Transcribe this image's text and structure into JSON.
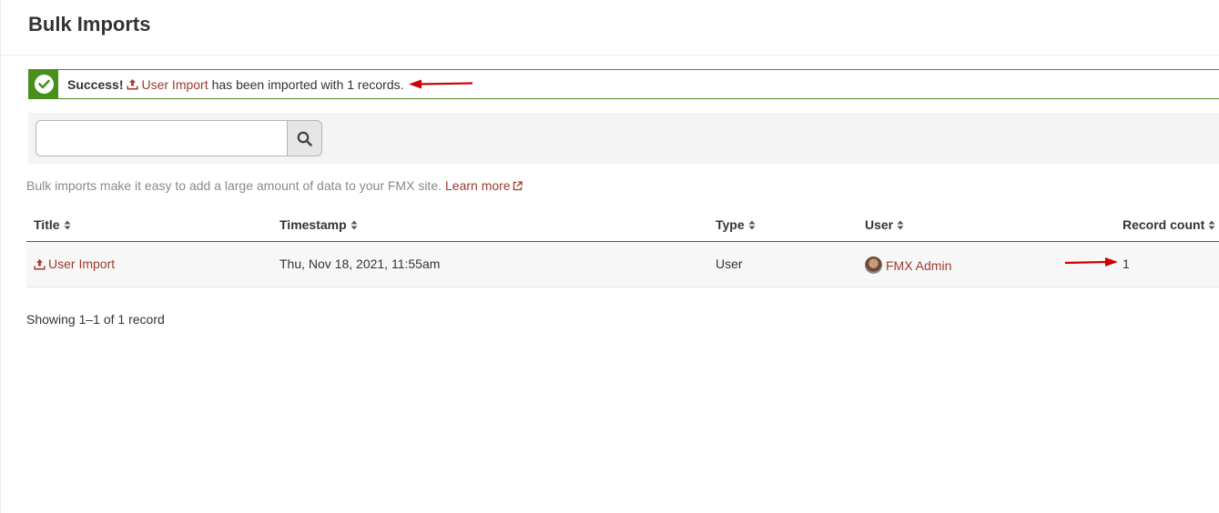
{
  "page": {
    "title": "Bulk Imports"
  },
  "alert": {
    "strong": "Success!",
    "link": "User Import",
    "message": "has been imported with 1 records.",
    "status_color": "#4a8f1e",
    "icon": "check-circle-icon"
  },
  "search": {
    "placeholder": "",
    "value": "",
    "button_icon": "search-icon"
  },
  "intro": {
    "text": "Bulk imports make it easy to add a large amount of data to your FMX site.",
    "link": "Learn more",
    "link_icon": "external-link-icon"
  },
  "table": {
    "columns": [
      "Title",
      "Timestamp",
      "Type",
      "User",
      "Record count"
    ],
    "rows": [
      {
        "title": "User Import",
        "timestamp": "Thu, Nov 18, 2021, 11:55am",
        "type": "User",
        "user": "FMX Admin",
        "record_count": "1"
      }
    ]
  },
  "pagination": {
    "summary": "Showing 1–1 of 1 record"
  },
  "colors": {
    "link": "#9e3a2e",
    "annotation_arrow": "#cc0000"
  }
}
